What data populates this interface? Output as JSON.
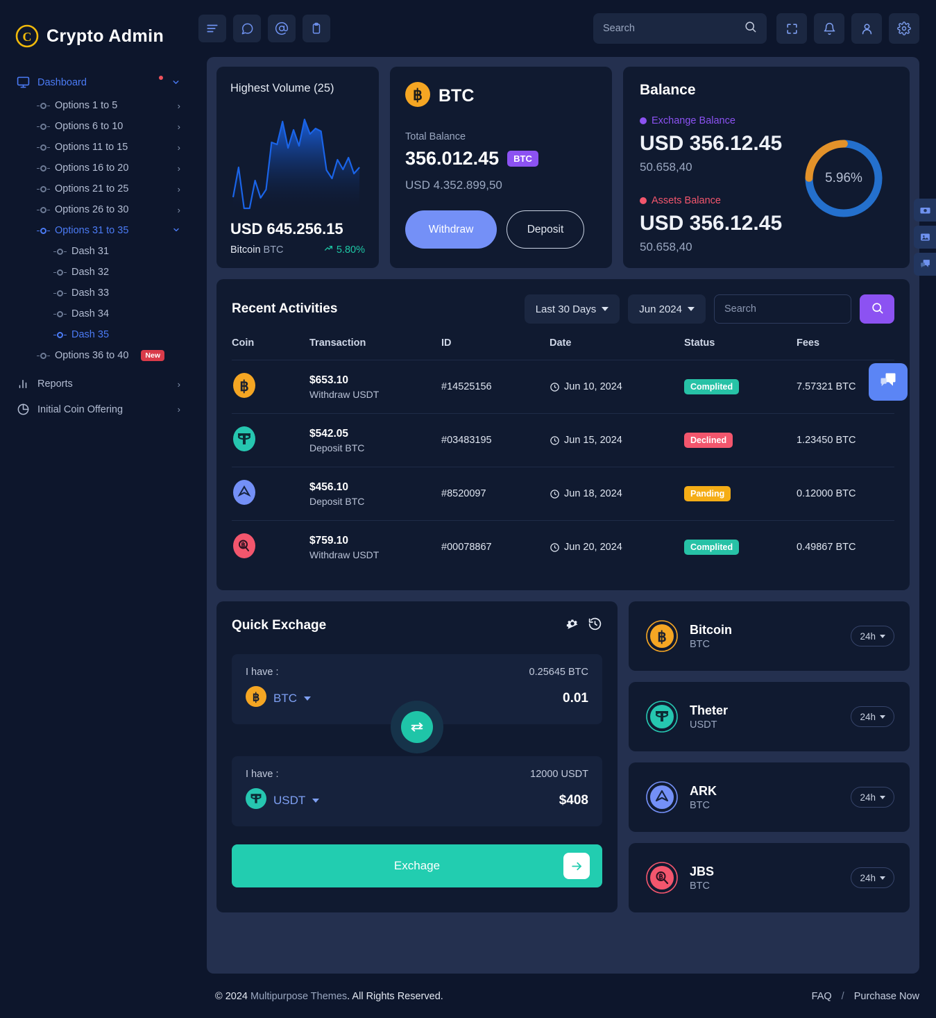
{
  "brand": {
    "name": "Crypto Admin",
    "logo_icon": "crypto-coin-logo"
  },
  "sidebar": {
    "dashboard": {
      "label": "Dashboard",
      "icon": "monitor-icon",
      "has_dot": true
    },
    "options": [
      {
        "label": "Options 1 to 5"
      },
      {
        "label": "Options 6 to 10"
      },
      {
        "label": "Options 11 to 15"
      },
      {
        "label": "Options 16 to 20"
      },
      {
        "label": "Options 21 to 25"
      },
      {
        "label": "Options 26 to 30"
      },
      {
        "label": "Options 31 to 35",
        "active": true
      }
    ],
    "dash_items": [
      {
        "label": "Dash 31"
      },
      {
        "label": "Dash 32"
      },
      {
        "label": "Dash 33"
      },
      {
        "label": "Dash 34"
      },
      {
        "label": "Dash 35",
        "active": true
      }
    ],
    "options_last": {
      "label": "Options 36 to 40",
      "badge": "New"
    },
    "reports": {
      "label": "Reports",
      "icon": "bar-chart-icon"
    },
    "ico": {
      "label": "Initial Coin Offering",
      "icon": "pie-chart-icon"
    }
  },
  "topbar": {
    "left_icons": [
      "menu-icon",
      "chat-bubble-icon",
      "at-mention-icon",
      "clipboard-icon"
    ],
    "search": {
      "placeholder": "Search",
      "value": "",
      "icon": "search-icon"
    },
    "right_icons": [
      "fullscreen-icon",
      "bell-icon",
      "user-icon",
      "gear-icon"
    ]
  },
  "volume_card": {
    "title": "Highest Volume (25)",
    "amount": "USD 645.256.15",
    "coin_name": "Bitcoin",
    "coin_symbol": "BTC",
    "change": "5.80%",
    "change_icon": "trend-up-icon",
    "change_color": "#1ec8a5"
  },
  "btc_card": {
    "coin": "BTC",
    "coin_icon": "bitcoin-icon",
    "total_balance_label": "Total Balance",
    "amount": "356.012.45",
    "chip": "BTC",
    "usd": "USD 4.352.899,50",
    "withdraw_label": "Withdraw",
    "deposit_label": "Deposit"
  },
  "balance_card": {
    "title": "Balance",
    "exchange": {
      "legend": "Exchange Balance",
      "color": "#8c52f2",
      "amount": "USD 356.12.45",
      "sub": "50.658,40"
    },
    "assets": {
      "legend": "Assets Balance",
      "color": "#f3566d",
      "amount": "USD 356.12.45",
      "sub": "50.658,40"
    },
    "donut_label": "5.96%"
  },
  "chart_data": [
    {
      "type": "area",
      "title": "Highest Volume (25)",
      "x": [
        0,
        1,
        2,
        3,
        4,
        5,
        6,
        7,
        8,
        9,
        10,
        11,
        12,
        13,
        14,
        15,
        16,
        17,
        18,
        19,
        20,
        21,
        22,
        23,
        24
      ],
      "values": [
        22,
        60,
        10,
        10,
        42,
        18,
        30,
        95,
        92,
        140,
        100,
        128,
        102,
        144,
        120,
        130,
        128,
        124,
        60,
        48,
        78,
        62,
        80,
        58,
        66
      ],
      "ylim": [
        0,
        150
      ],
      "grid": false,
      "line_color": "#1a64e8",
      "fill": "gradient-blue"
    },
    {
      "type": "pie",
      "title": "Balance",
      "labels": [
        "Exchange Balance",
        "Assets Balance"
      ],
      "values": [
        25,
        75
      ],
      "colors": [
        "#e3922a",
        "#2470cd"
      ],
      "center_label": "5.96%",
      "donut": true
    }
  ],
  "recent": {
    "title": "Recent Activities",
    "range_filter": "Last 30 Days",
    "month_filter": "Jun 2024",
    "search_placeholder": "Search",
    "search_value": "",
    "search_button_icon": "search-icon",
    "columns": [
      "Coin",
      "Transaction",
      "ID",
      "Date",
      "Status",
      "Fees"
    ],
    "rows": [
      {
        "coin_icon": "bitcoin-icon",
        "coin_color": "#f5a623",
        "amount": "$653.10",
        "type": "Withdraw USDT",
        "id": "#14525156",
        "date": "Jun 10, 2024",
        "status": "Complited",
        "status_class": "p-completed",
        "fees": "7.57321 BTC"
      },
      {
        "coin_icon": "tether-icon",
        "coin_color": "#26c6b0",
        "amount": "$542.05",
        "type": "Deposit BTC",
        "id": "#03483195",
        "date": "Jun 15, 2024",
        "status": "Declined",
        "status_class": "p-declined",
        "fees": "1.23450 BTC"
      },
      {
        "coin_icon": "ark-icon",
        "coin_color": "#7490f7",
        "amount": "$456.10",
        "type": "Deposit BTC",
        "id": "#8520097",
        "date": "Jun 18, 2024",
        "status": "Panding",
        "status_class": "p-panding",
        "fees": "0.12000 BTC"
      },
      {
        "coin_icon": "jbs-icon",
        "coin_color": "#f3566d",
        "amount": "$759.10",
        "type": "Withdraw USDT",
        "id": "#00078867",
        "date": "Jun 20, 2024",
        "status": "Complited",
        "status_class": "p-completed",
        "fees": "0.49867 BTC"
      }
    ]
  },
  "quick_exchange": {
    "title": "Quick Exchage",
    "settings_icon": "gear-icon",
    "history_icon": "history-icon",
    "from": {
      "label": "I have :",
      "balance": "0.25645 BTC",
      "coin": "BTC",
      "coin_icon": "bitcoin-icon",
      "value": "0.01"
    },
    "swap_icon": "swap-arrows-icon",
    "to": {
      "label": "I have :",
      "balance": "12000 USDT",
      "coin": "USDT",
      "coin_icon": "tether-icon",
      "value": "$408"
    },
    "button_label": "Exchage",
    "button_icon": "arrow-right-icon"
  },
  "coin_list": [
    {
      "name": "Bitcoin",
      "symbol": "BTC",
      "icon": "bitcoin-icon",
      "color": "#f5a623",
      "period": "24h"
    },
    {
      "name": "Theter",
      "symbol": "USDT",
      "icon": "tether-icon",
      "color": "#26c6b0",
      "period": "24h"
    },
    {
      "name": "ARK",
      "symbol": "BTC",
      "icon": "ark-icon",
      "color": "#7490f7",
      "period": "24h"
    },
    {
      "name": "JBS",
      "symbol": "BTC",
      "icon": "jbs-icon",
      "color": "#f3566d",
      "period": "24h"
    }
  ],
  "footer": {
    "copyright_prefix": "© 2024 ",
    "company": "Multipurpose Themes",
    "copyright_suffix": ". All Rights Reserved.",
    "faq": "FAQ",
    "separator": "/",
    "purchase": "Purchase Now"
  },
  "rail_icons": [
    "camera-icon",
    "image-icon",
    "chat-icon"
  ],
  "float_chat_icon": "chat-icon"
}
